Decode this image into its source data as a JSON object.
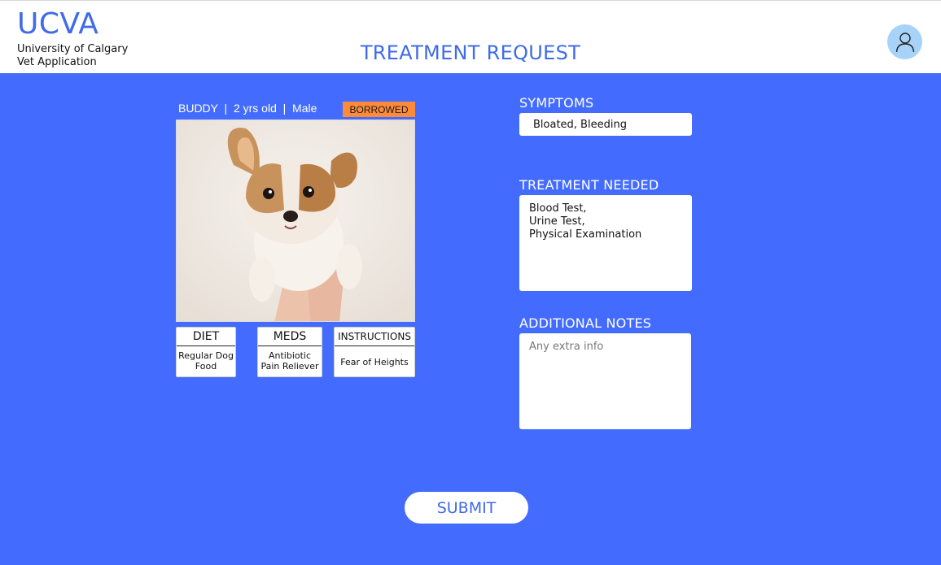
{
  "header": {
    "logo_title": "UCVA",
    "logo_subtitle_line1": "University of Calgary",
    "logo_subtitle_line2": "Vet Application",
    "page_title": "TREATMENT REQUEST",
    "avatar_icon": "user-icon",
    "avatar_bg": "#a7d3f8"
  },
  "pet": {
    "info": "BUDDY  |  2 yrs old  |  Male",
    "status_badge": "BORROWED",
    "status_color": "#ff8a3a",
    "photo_icon": "puppy-photo"
  },
  "cards": {
    "diet": {
      "title": "DIET",
      "line1": "Regular Dog",
      "line2": "Food"
    },
    "meds": {
      "title": "MEDS",
      "line1": "Antibiotic",
      "line2": "Pain Reliever"
    },
    "instructions": {
      "title": "INSTRUCTIONS",
      "line1": "Fear of Heights"
    }
  },
  "form": {
    "symptoms_label": "SYMPTOMS",
    "symptoms_value": "Bloated, Bleeding",
    "treatment_label": "TREATMENT NEEDED",
    "treatment_value": "Blood Test,\nUrine Test,\nPhysical Examination",
    "notes_label": "ADDITIONAL NOTES",
    "notes_placeholder": "Any extra info",
    "submit_label": "SUBMIT"
  },
  "colors": {
    "background": "#436cff",
    "accent": "#3f6be8"
  }
}
